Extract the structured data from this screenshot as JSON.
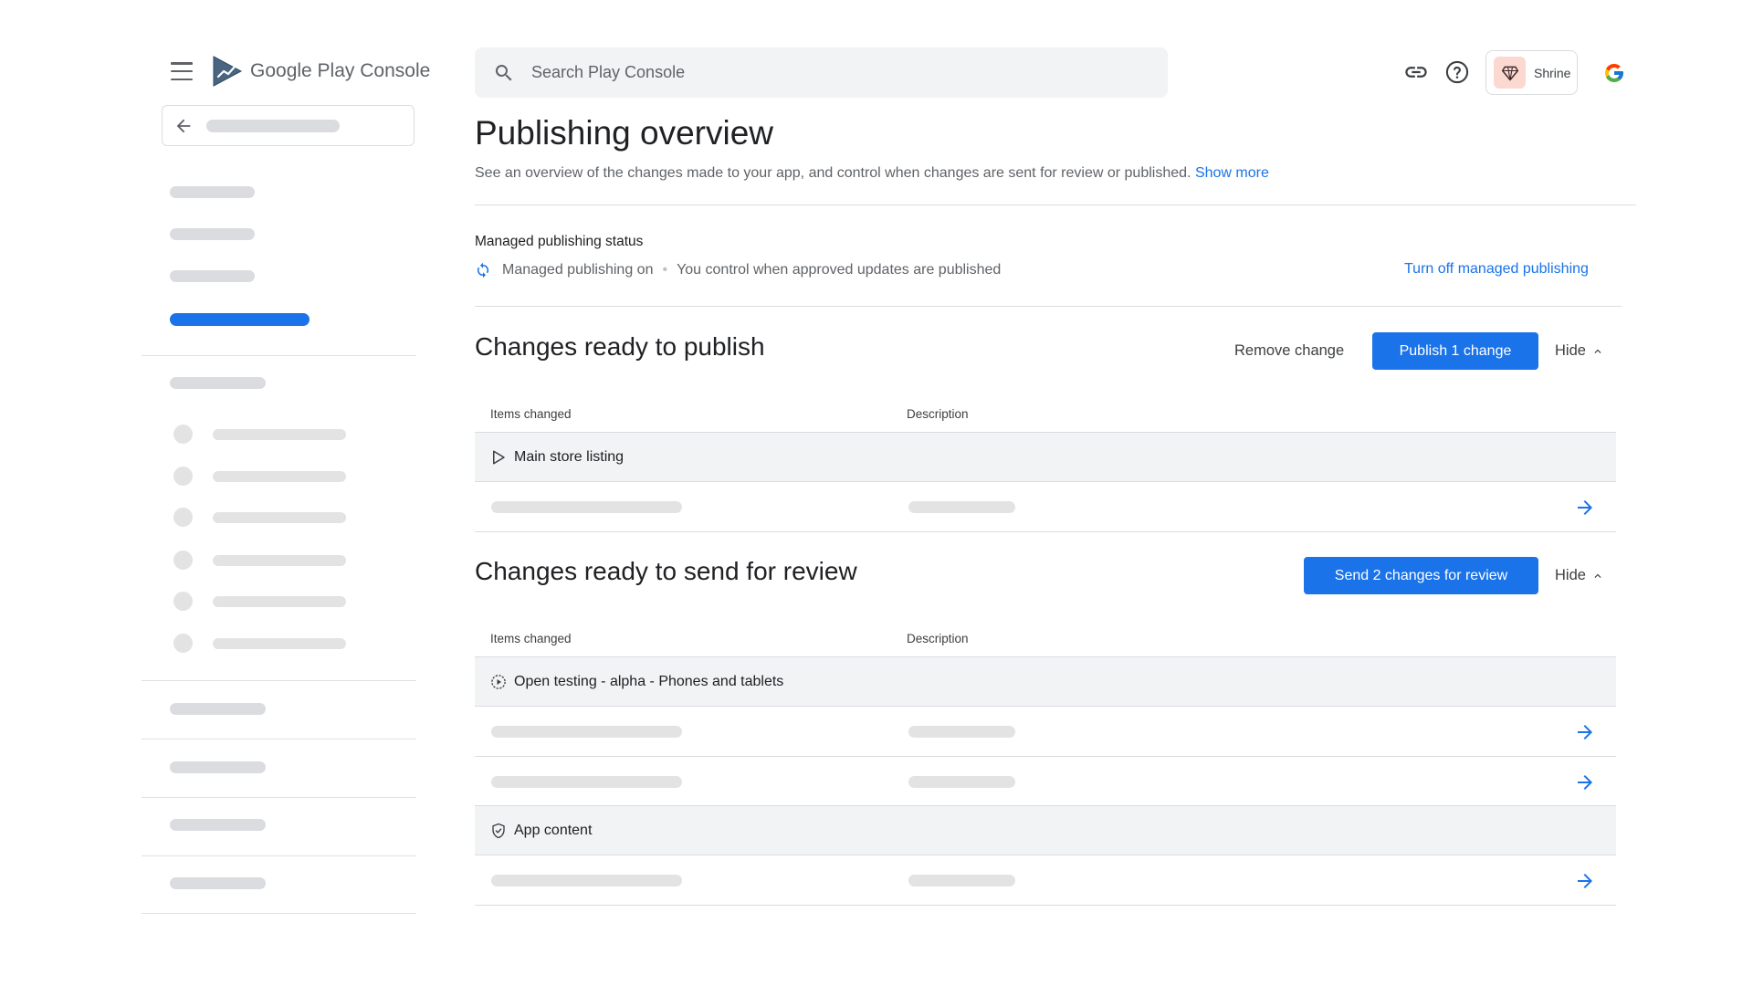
{
  "app": {
    "logo_text_main": "Google Play",
    "logo_text_sub": "Console"
  },
  "search": {
    "placeholder": "Search Play Console"
  },
  "account": {
    "app_name": "Shrine"
  },
  "page": {
    "title": "Publishing overview",
    "description": "See an overview of the changes made to your app, and control when changes are sent for review or published.",
    "show_more": "Show more"
  },
  "managed_status": {
    "title": "Managed publishing status",
    "state": "Managed publishing on",
    "separator": "•",
    "detail": "You control when approved updates are published",
    "turn_off": "Turn off managed publishing"
  },
  "publish_section": {
    "title": "Changes ready to publish",
    "remove_label": "Remove change",
    "publish_label": "Publish 1 change",
    "hide_label": "Hide",
    "col_items": "Items changed",
    "col_description": "Description",
    "groups": [
      {
        "label": "Main store listing",
        "icon": "play-outline-icon"
      }
    ]
  },
  "review_section": {
    "title": "Changes ready to send for review",
    "send_label": "Send 2 changes for review",
    "hide_label": "Hide",
    "col_items": "Items changed",
    "col_description": "Description",
    "groups": [
      {
        "label": "Open testing - alpha - Phones and tablets",
        "icon": "testing-icon"
      },
      {
        "label": "App content",
        "icon": "shield-icon"
      }
    ]
  },
  "colors": {
    "accent": "#1a73e8",
    "placeholder": "#dadce0",
    "row_bg": "#f1f3f4",
    "shrine_bg": "#fbd9d1"
  }
}
